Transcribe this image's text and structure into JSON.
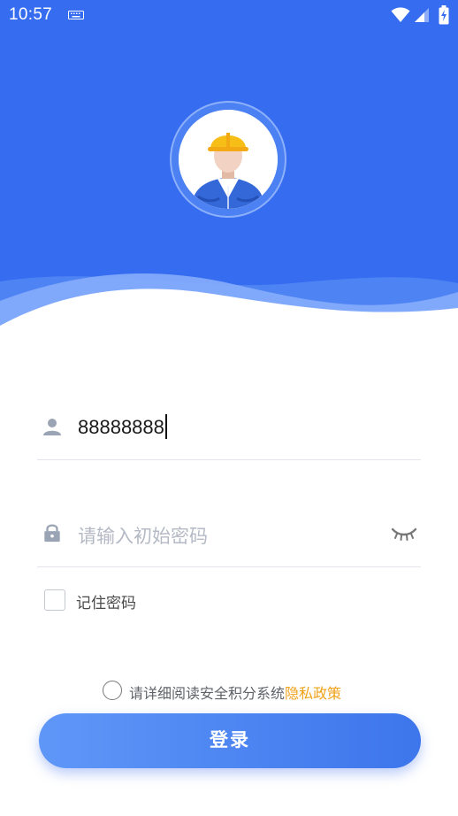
{
  "status_bar": {
    "time": "10:57",
    "icons": [
      "keyboard-icon",
      "wifi-icon",
      "signal-icon",
      "battery-charging-icon"
    ]
  },
  "header": {
    "avatar": "worker-avatar-icon",
    "background_color": "#356cf0"
  },
  "form": {
    "username": {
      "icon": "user-icon",
      "value": "88888888"
    },
    "password": {
      "icon": "lock-icon",
      "placeholder": "请输入初始密码",
      "toggle_icon": "eye-closed-icon"
    },
    "remember": {
      "label": "记住密码",
      "checked": false
    }
  },
  "policy": {
    "text": "请详细阅读安全积分系统",
    "link": "隐私政策",
    "checked": false,
    "link_color": "#f0a21a"
  },
  "login_button": {
    "label": "登录"
  }
}
